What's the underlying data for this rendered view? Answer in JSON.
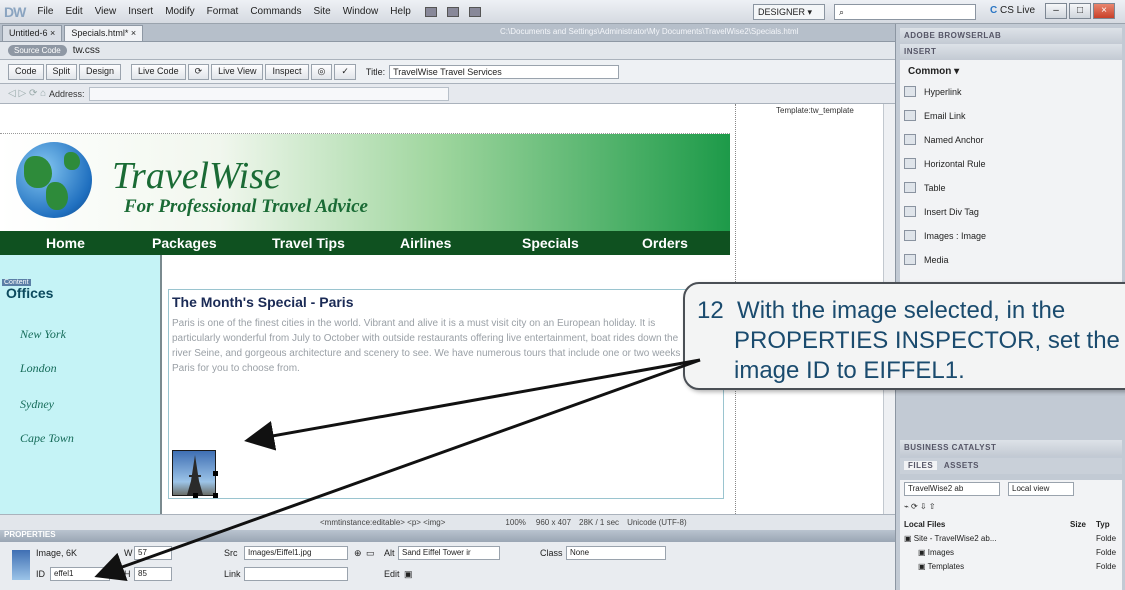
{
  "menubar": {
    "logo": "DW",
    "items": [
      "File",
      "Edit",
      "View",
      "Insert",
      "Modify",
      "Format",
      "Commands",
      "Site",
      "Window",
      "Help"
    ],
    "workspace": "DESIGNER",
    "search": "",
    "cslive": "CS Live"
  },
  "doctabs": {
    "tabs": [
      "Untitled-6",
      "Specials.html*"
    ],
    "path": "C:\\Documents and Settings\\Administrator\\My Documents\\TravelWise2\\Specials.html"
  },
  "related": {
    "source_code": "Source Code",
    "file": "tw.css"
  },
  "toolbar": {
    "code": "Code",
    "split": "Split",
    "design": "Design",
    "live_code": "Live Code",
    "live_view": "Live View",
    "inspect": "Inspect",
    "title_label": "Title:",
    "title_value": "TravelWise Travel Services"
  },
  "address": {
    "label": "Address:"
  },
  "page": {
    "template_label": "Template:tw_template",
    "brand": "TravelWise",
    "tagline": "For Professional Travel Advice",
    "nav": [
      "Home",
      "Packages",
      "Travel Tips",
      "Airlines",
      "Specials",
      "Orders"
    ],
    "content_tag": "Content",
    "offices_title": "Offices",
    "cities": [
      "New York",
      "London",
      "Sydney",
      "Cape Town"
    ],
    "main_title": "The Month's Special - Paris",
    "paragraph": "Paris is one of the finest cities in the world. Vibrant and alive it is a must visit city on an European holiday. It is particularly wonderful from July to October with outside restaurants offering live entertainment, boat rides down the river Seine, and gorgeous architecture and scenery to see. We have numerous tours that include one or two weeks in Paris for you to choose from."
  },
  "status": {
    "tags": "<mmtinstance:editable> <p> <img>",
    "zoom": "100%",
    "size": "960 x 407",
    "weight": "28K / 1 sec",
    "encoding": "Unicode (UTF-8)"
  },
  "properties": {
    "title": "PROPERTIES",
    "type": "Image, 6K",
    "w_label": "W",
    "w_value": "57",
    "h_label": "H",
    "h_value": "85",
    "id_label": "ID",
    "id_value": "effel1",
    "src_label": "Src",
    "src_value": "Images/Eiffel1.jpg",
    "link_label": "Link",
    "link_value": "",
    "alt_label": "Alt",
    "alt_value": "Sand Eiffel Tower ir",
    "edit_label": "Edit",
    "class_label": "Class",
    "class_value": "None"
  },
  "rightpanel": {
    "browserlab": "ADOBE BROWSERLAB",
    "insert": "INSERT",
    "category": "Common",
    "items": [
      "Hyperlink",
      "Email Link",
      "Named Anchor",
      "Horizontal Rule",
      "Table",
      "Insert Div Tag",
      "Images : Image",
      "Media"
    ],
    "catalyst": "BUSINESS CATALYST",
    "files_tab": "FILES",
    "assets_tab": "ASSETS",
    "site_select": "TravelWise2 ab",
    "view_select": "Local view",
    "col_local": "Local Files",
    "col_size": "Size",
    "col_type": "Typ",
    "files": [
      {
        "name": "Site - TravelWise2 ab...",
        "type": "Folde"
      },
      {
        "name": "Images",
        "type": "Folde"
      },
      {
        "name": "Templates",
        "type": "Folde"
      }
    ]
  },
  "callout": {
    "step": "12",
    "lines": [
      "With the image selected, in the",
      "PROPERTIES INSPECTOR, set the",
      "image ID to EIFFEL1."
    ]
  }
}
